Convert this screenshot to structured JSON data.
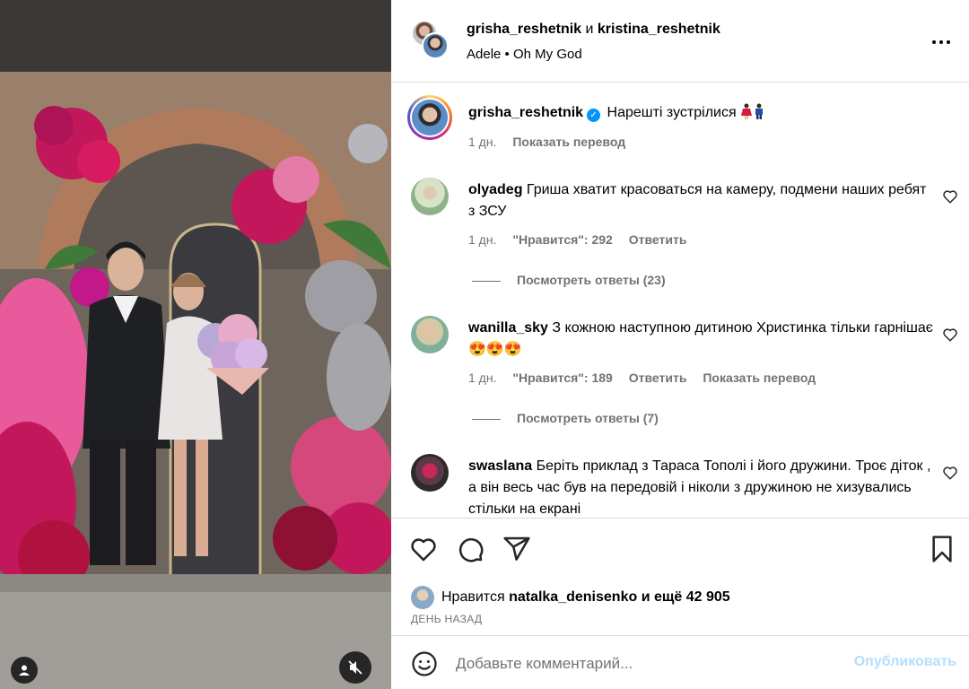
{
  "header": {
    "user1": "grisha_reshetnik",
    "conjunction": "и",
    "user2": "kristina_reshetnik",
    "audio_artist": "Adele",
    "audio_separator": "•",
    "audio_title": "Oh My God"
  },
  "caption": {
    "username": "grisha_reshetnik",
    "text": "Нарешті зустрілися",
    "time": "1 дн.",
    "translate": "Показать перевод"
  },
  "comments": [
    {
      "username": "olyadeg",
      "text": "Гриша хватит красоваться на камеру, подмени наших ребят з ЗСУ",
      "time": "1 дн.",
      "likes": "\"Нравится\": 292",
      "reply": "Ответить",
      "view_replies": "Посмотреть ответы (23)"
    },
    {
      "username": "wanilla_sky",
      "text": "З кожною наступною дитиною Христинка тільки гарнішає",
      "emojis": "😍😍😍",
      "time": "1 дн.",
      "likes": "\"Нравится\": 189",
      "reply": "Ответить",
      "translate": "Показать перевод",
      "view_replies": "Посмотреть ответы (7)"
    },
    {
      "username": "swaslana",
      "text": "Беріть приклад з Тараса Тополі і його дружини. Троє діток , а він весь час був на передовій і ніколи з дружиною не хизувались стільки на екрані"
    }
  ],
  "likes": {
    "prefix": "Нравится",
    "user": "natalka_denisenko",
    "suffix": "и ещё 42 905",
    "time": "ДЕНЬ НАЗАД"
  },
  "add_comment": {
    "placeholder": "Добавьте комментарий...",
    "publish": "Опубликовать"
  },
  "icons": [
    "more-icon",
    "verified-icon",
    "heart-icon",
    "comment-icon",
    "share-icon",
    "bookmark-icon",
    "smiley-icon",
    "user-tag-icon",
    "mute-icon"
  ],
  "colors": {
    "accent": "#0095f6",
    "secondary_text": "#737373",
    "publish_disabled": "#b2dffc",
    "divider": "#dbdbdb"
  }
}
